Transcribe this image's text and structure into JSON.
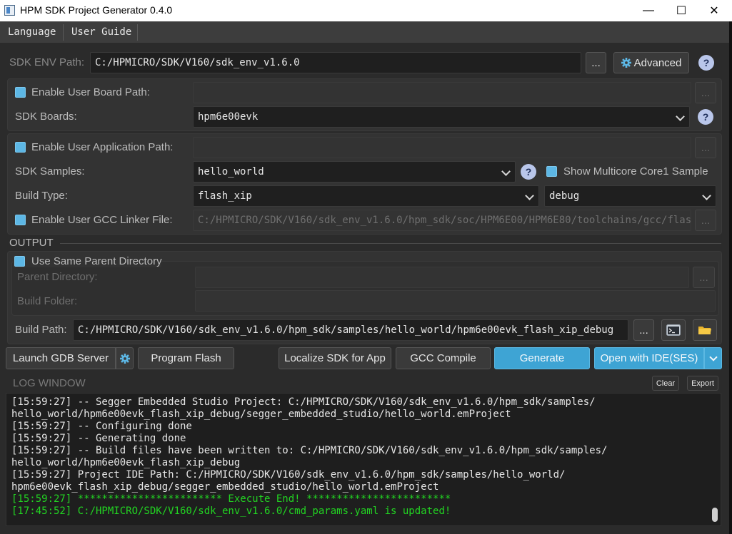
{
  "window": {
    "title": "HPM SDK Project Generator 0.4.0",
    "minimize": "—",
    "maximize": "☐",
    "close": "✕"
  },
  "menu": {
    "language": "Language",
    "user_guide": "User Guide"
  },
  "sdk_env": {
    "label": "SDK ENV Path:",
    "value": "C:/HPMICRO/SDK/V160/sdk_env_v1.6.0",
    "browse": "...",
    "advanced": "Advanced",
    "help": "?"
  },
  "board": {
    "enable_user_board_label": "Enable User Board Path:",
    "browse": "...",
    "sdk_boards_label": "SDK Boards:",
    "sdk_boards_value": "hpm6e00evk",
    "help": "?"
  },
  "application": {
    "enable_user_app_label": "Enable User Application Path:",
    "browse": "...",
    "sdk_samples_label": "SDK Samples:",
    "sdk_samples_value": "hello_world",
    "help": "?",
    "multicore_label": "Show Multicore Core1 Sample",
    "build_type_label": "Build Type:",
    "build_type_value": "flash_xip",
    "build_config_value": "debug",
    "linker_label": "Enable User GCC Linker File:",
    "linker_value": "C:/HPMICRO/SDK/V160/sdk_env_v1.6.0/hpm_sdk/soc/HPM6E00/HPM6E80/toolchains/gcc/flash_xip.ld",
    "linker_browse": "..."
  },
  "output": {
    "section_label": "OUTPUT",
    "same_parent_label": "Use Same Parent Directory",
    "parent_dir_label": "Parent Directory:",
    "parent_browse": "...",
    "build_folder_label": "Build Folder:",
    "build_path_label": "Build Path:",
    "build_path_value": "C:/HPMICRO/SDK/V160/sdk_env_v1.6.0/hpm_sdk/samples/hello_world/hpm6e00evk_flash_xip_debug",
    "build_path_browse": "..."
  },
  "actions": {
    "launch_gdb": "Launch GDB Server",
    "program_flash": "Program Flash",
    "localize_sdk": "Localize SDK for App",
    "gcc_compile": "GCC Compile",
    "generate": "Generate",
    "open_ide": "Open with IDE(SES)"
  },
  "log": {
    "title": "LOG WINDOW",
    "clear": "Clear",
    "export": "Export",
    "lines": [
      {
        "text": "[15:59:27] -- Segger Embedded Studio Project: C:/HPMICRO/SDK/V160/sdk_env_v1.6.0/hpm_sdk/samples/",
        "color": "white"
      },
      {
        "text": "hello_world/hpm6e00evk_flash_xip_debug/segger_embedded_studio/hello_world.emProject",
        "color": "white"
      },
      {
        "text": "[15:59:27] -- Configuring done",
        "color": "white"
      },
      {
        "text": "[15:59:27] -- Generating done",
        "color": "white"
      },
      {
        "text": "[15:59:27] -- Build files have been written to: C:/HPMICRO/SDK/V160/sdk_env_v1.6.0/hpm_sdk/samples/",
        "color": "white"
      },
      {
        "text": "hello_world/hpm6e00evk_flash_xip_debug",
        "color": "white"
      },
      {
        "text": "[15:59:27] Project IDE Path: C:/HPMICRO/SDK/V160/sdk_env_v1.6.0/hpm_sdk/samples/hello_world/",
        "color": "white"
      },
      {
        "text": "hpm6e00evk_flash_xip_debug/segger_embedded_studio/hello_world.emProject",
        "color": "white"
      },
      {
        "text": "[15:59:27] ************************ Execute End! ************************",
        "color": "green"
      },
      {
        "text": "[17:45:52] C:/HPMICRO/SDK/V160/sdk_env_v1.6.0/cmd_params.yaml is updated!",
        "color": "green"
      }
    ]
  },
  "colors": {
    "accent": "#3ea4d4",
    "checkbox": "#5db7e5",
    "log_green": "#22d422"
  }
}
